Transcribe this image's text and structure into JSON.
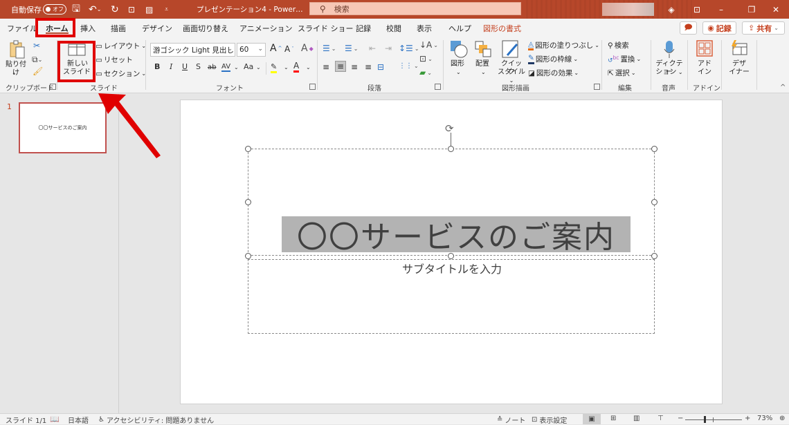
{
  "titlebar": {
    "autosave_label": "自動保存",
    "autosave_state": "オフ",
    "doc_title": "プレゼンテーション4 - Power…",
    "search_placeholder": "検索",
    "icons": [
      "save-icon",
      "undo-icon",
      "redo-icon",
      "present-icon",
      "insert-picture-icon",
      "customize-qat-icon"
    ],
    "window_controls": [
      "diamond-icon",
      "ribbon-display-icon",
      "minimize-icon",
      "restore-icon",
      "close-icon"
    ]
  },
  "tabs": [
    {
      "label": "ファイル",
      "active": false
    },
    {
      "label": "ホーム",
      "active": true
    },
    {
      "label": "挿入",
      "active": false
    },
    {
      "label": "描画",
      "active": false
    },
    {
      "label": "デザイン",
      "active": false
    },
    {
      "label": "画面切り替え",
      "active": false
    },
    {
      "label": "アニメーション",
      "active": false
    },
    {
      "label": "スライド ショー",
      "active": false
    },
    {
      "label": "記録",
      "active": false
    },
    {
      "label": "校閲",
      "active": false
    },
    {
      "label": "表示",
      "active": false
    },
    {
      "label": "ヘルプ",
      "active": false
    },
    {
      "label": "図形の書式",
      "active": false,
      "contextual": true
    }
  ],
  "header_buttons": {
    "comment": "",
    "record": "記録",
    "share": "共有"
  },
  "ribbon": {
    "clipboard": {
      "paste": "貼り付け",
      "group": "クリップボード"
    },
    "slides": {
      "new_slide_line1": "新しい",
      "new_slide_line2": "スライド",
      "layout": "レイアウト",
      "reset": "リセット",
      "section": "セクション",
      "group": "スライド"
    },
    "font": {
      "font_name": "游ゴシック Light 見出し",
      "font_size": "60",
      "bold": "B",
      "italic": "I",
      "underline": "U",
      "shadow": "S",
      "strike": "ab",
      "spacing": "AV",
      "case": "Aa",
      "grow": "A",
      "shrink": "A",
      "group": "フォント",
      "highlight_color": "#ffff00",
      "font_color": "#ff0000"
    },
    "paragraph": {
      "group": "段落"
    },
    "drawing": {
      "shapes": "図形",
      "arrange": "配置",
      "quick_style_1": "クイック",
      "quick_style_2": "スタイル",
      "fill": "図形の塗りつぶし",
      "outline": "図形の枠線",
      "effects": "図形の効果",
      "group": "図形描画"
    },
    "editing": {
      "find": "検索",
      "replace": "置換",
      "select": "選択",
      "group": "編集"
    },
    "voice": {
      "dictate_1": "ディクテー",
      "dictate_2": "ション",
      "group": "音声"
    },
    "addins": {
      "addin_1": "アド",
      "addin_2": "イン",
      "group": "アドイン"
    },
    "designer": {
      "designer_1": "デザ",
      "designer_2": "イナー"
    }
  },
  "slides_panel": {
    "slide_number": "1",
    "thumb_text": "〇〇サービスのご案内"
  },
  "slide": {
    "title": "〇〇サービスのご案内",
    "subtitle_placeholder": "サブタイトルを入力"
  },
  "statusbar": {
    "slide_count": "スライド 1/1",
    "language": "日本語",
    "accessibility": "アクセシビリティ: 問題ありません",
    "notes": "ノート",
    "display_settings": "表示設定",
    "zoom_minus": "−",
    "zoom_plus": "+",
    "zoom": "73%",
    "zoom_fraction": 0.73
  },
  "annotations": {
    "highlight_color": "#e00000"
  }
}
